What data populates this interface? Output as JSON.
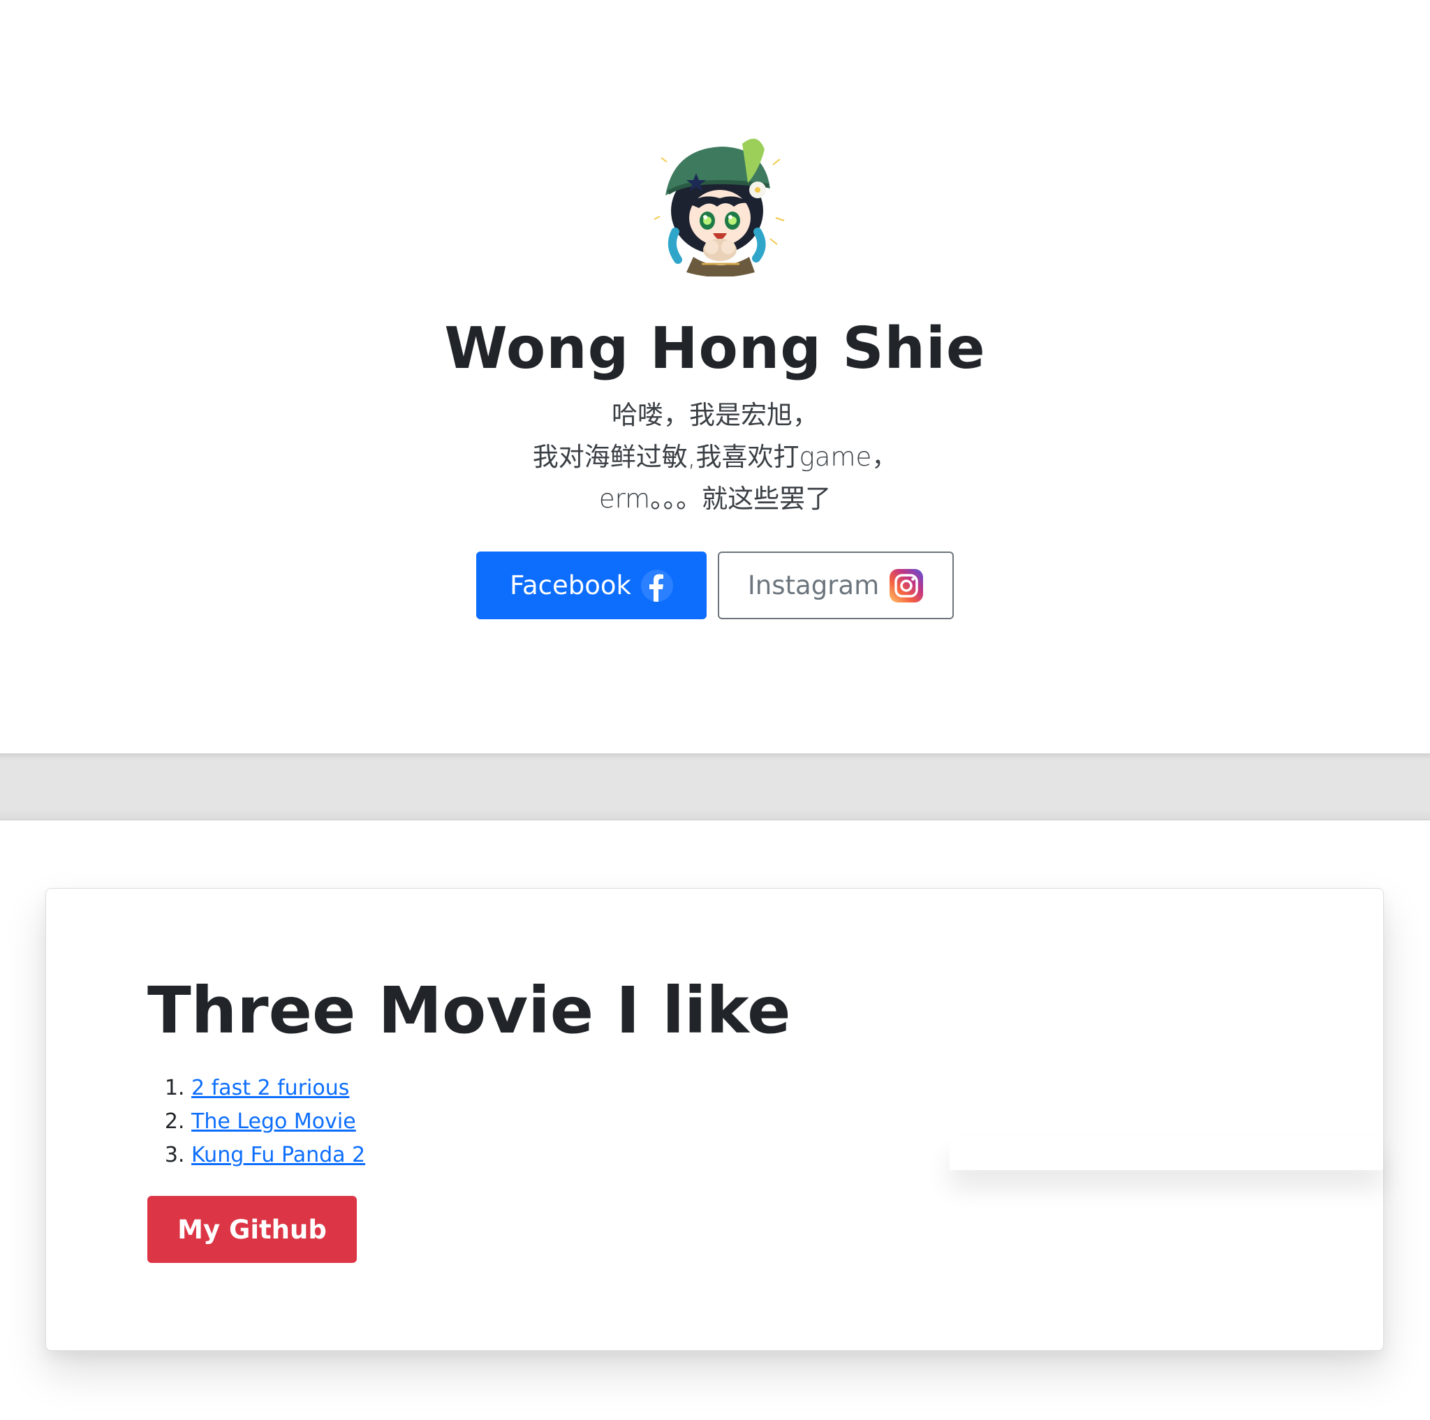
{
  "hero": {
    "avatar_alt": "chibi character avatar",
    "name": "Wong Hong Shie",
    "bio_lines": [
      "哈喽，我是宏旭，",
      "我对海鲜过敏,我喜欢打game，",
      "erm。。。就这些罢了"
    ],
    "buttons": {
      "facebook_label": "Facebook",
      "facebook_icon": "facebook-icon",
      "instagram_label": "Instagram",
      "instagram_icon": "instagram-icon"
    }
  },
  "movies": {
    "title": "Three Movie I like",
    "items": [
      {
        "label": "2 fast 2 furious"
      },
      {
        "label": "The Lego Movie"
      },
      {
        "label": "Kung Fu Panda 2"
      }
    ],
    "github_label": "My Github"
  },
  "colors": {
    "primary": "#0d6efd",
    "danger": "#dc3545",
    "secondary": "#6c757d",
    "text": "#212529"
  }
}
